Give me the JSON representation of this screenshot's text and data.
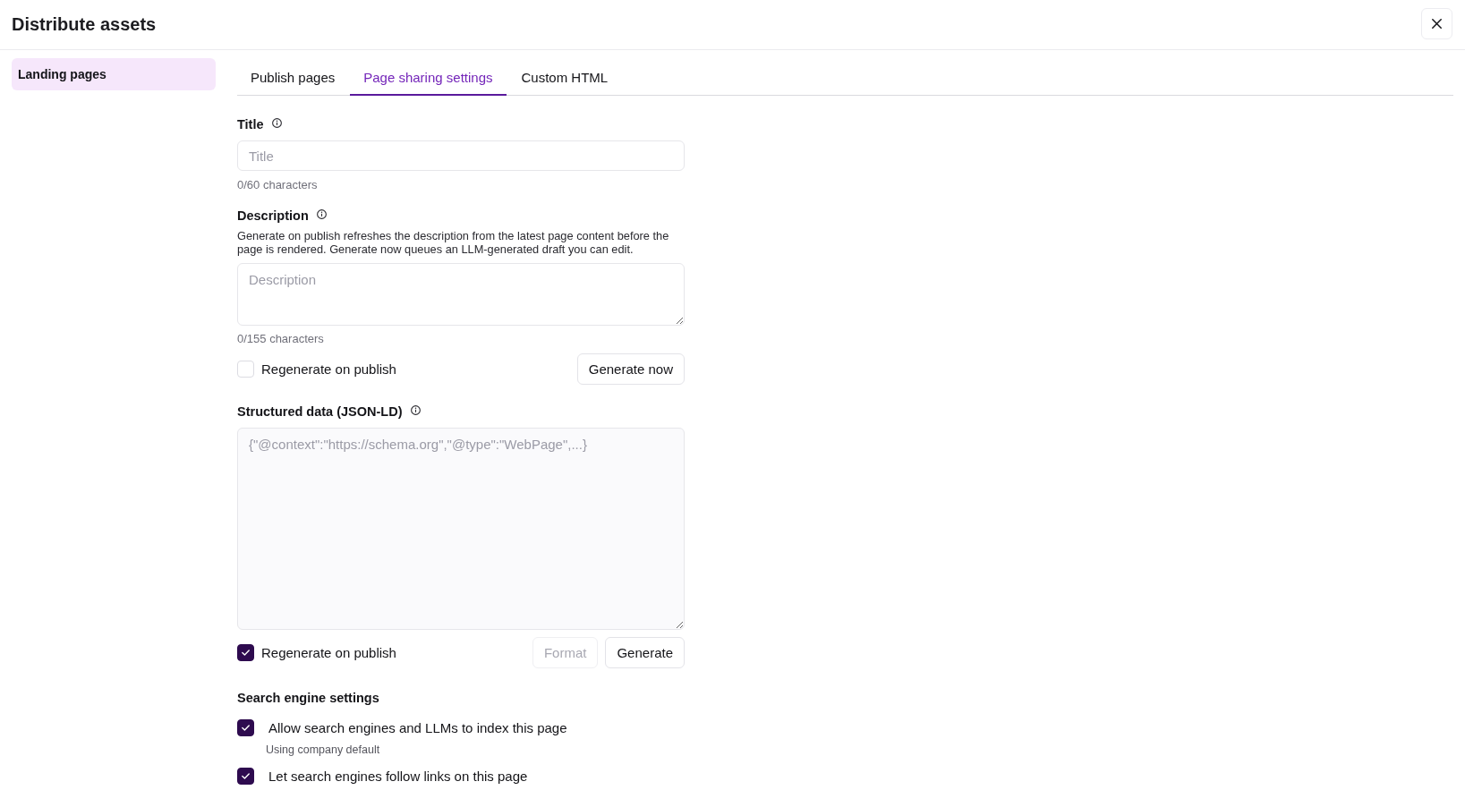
{
  "dialog": {
    "title": "Distribute assets"
  },
  "sidebar": {
    "items": [
      {
        "label": "Landing pages",
        "selected": true
      }
    ]
  },
  "tabs": [
    {
      "label": "Publish pages",
      "selected": false
    },
    {
      "label": "Page sharing settings",
      "selected": true
    },
    {
      "label": "Custom HTML",
      "selected": false
    }
  ],
  "form": {
    "title_field": {
      "label": "Title",
      "placeholder": "Title",
      "counter": "0/60 characters"
    },
    "description_field": {
      "label": "Description",
      "help": "Generate on publish refreshes the description from the latest page content before the page is rendered. Generate now queues an LLM-generated draft you can edit.",
      "placeholder": "Description",
      "counter": "0/155 characters",
      "regenerate": {
        "label": "Regenerate on publish",
        "checked": false
      },
      "buttons": [
        {
          "label": "Generate now",
          "disabled": false
        }
      ]
    },
    "structured_data": {
      "label": "Structured data (JSON-LD)",
      "placeholder": "{\"@context\":\"https://schema.org\",\"@type\":\"WebPage\",...}",
      "regenerate": {
        "label": "Regenerate on publish",
        "checked": true
      },
      "buttons": [
        {
          "label": "Format",
          "disabled": true
        },
        {
          "label": "Generate",
          "disabled": false
        }
      ]
    },
    "search_engine": {
      "heading": "Search engine settings",
      "options": [
        {
          "label": "Allow search engines and LLMs to index this page",
          "checked": true,
          "note": "Using company default"
        },
        {
          "label": "Let search engines follow links on this page",
          "checked": true
        }
      ]
    }
  }
}
